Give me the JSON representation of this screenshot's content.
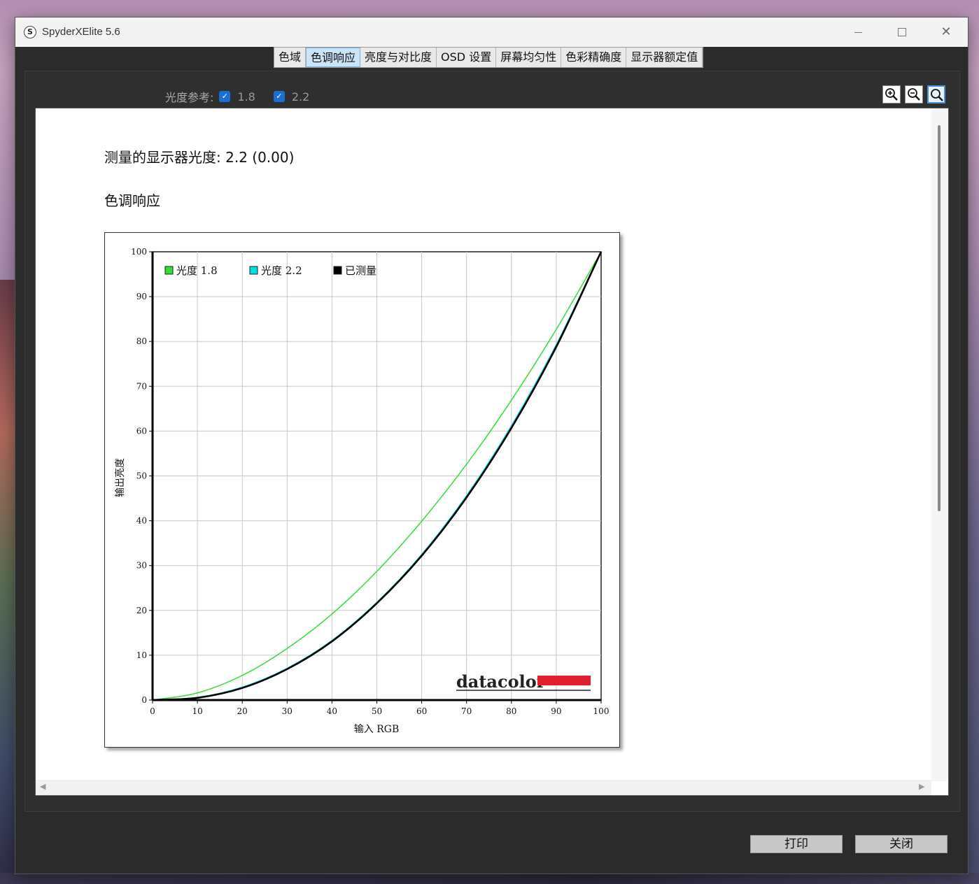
{
  "window": {
    "title": "SpyderXElite 5.6",
    "controls": {
      "minimize": "minimize-icon",
      "maximize": "maximize-icon",
      "close": "close-icon"
    }
  },
  "tabs": [
    {
      "label": "色域",
      "active": false
    },
    {
      "label": "色调响应",
      "active": true
    },
    {
      "label": "亮度与对比度",
      "active": false
    },
    {
      "label": "OSD 设置",
      "active": false
    },
    {
      "label": "屏幕均匀性",
      "active": false
    },
    {
      "label": "色彩精确度",
      "active": false
    },
    {
      "label": "显示器额定值",
      "active": false
    }
  ],
  "reference": {
    "label": "光度参考:",
    "options": [
      {
        "value": "1.8",
        "checked": true
      },
      {
        "value": "2.2",
        "checked": true
      }
    ]
  },
  "zoom": {
    "icons": [
      "zoom-in-icon",
      "zoom-out-icon",
      "zoom-fit-icon"
    ],
    "active": "zoom-fit-icon"
  },
  "report": {
    "measured_label": "测量的显示器光度:",
    "measured_value": "2.2 (0.00)",
    "section_title": "色调响应"
  },
  "chart_data": {
    "type": "line",
    "xlabel": "输入 RGB",
    "ylabel": "输出亮度",
    "xlim": [
      0,
      100
    ],
    "ylim": [
      0,
      100
    ],
    "xticks": [
      0,
      10,
      20,
      30,
      40,
      50,
      60,
      70,
      80,
      90,
      100
    ],
    "yticks": [
      0,
      10,
      20,
      30,
      40,
      50,
      60,
      70,
      80,
      90,
      100
    ],
    "grid": true,
    "legend_position": "top-left",
    "watermark": "datacolor",
    "x": [
      0,
      10,
      20,
      30,
      40,
      50,
      60,
      70,
      80,
      90,
      100
    ],
    "series": [
      {
        "name": "光度 1.8",
        "color": "#33dd33",
        "values": [
          0,
          1.6,
          5.5,
          11.5,
          19.2,
          28.7,
          39.9,
          52.6,
          66.9,
          82.7,
          100
        ]
      },
      {
        "name": "光度 2.2",
        "color": "#00e0e0",
        "values": [
          0,
          0.6,
          2.9,
          7.1,
          13.3,
          21.8,
          32.5,
          45.6,
          61.2,
          79.3,
          100
        ]
      },
      {
        "name": "已测量",
        "color": "#000000",
        "values": [
          0,
          0.5,
          2.7,
          6.9,
          13.1,
          21.6,
          32.2,
          45.2,
          60.7,
          78.8,
          100
        ]
      }
    ]
  },
  "footer": {
    "print_label": "打印",
    "close_label": "关闭"
  }
}
